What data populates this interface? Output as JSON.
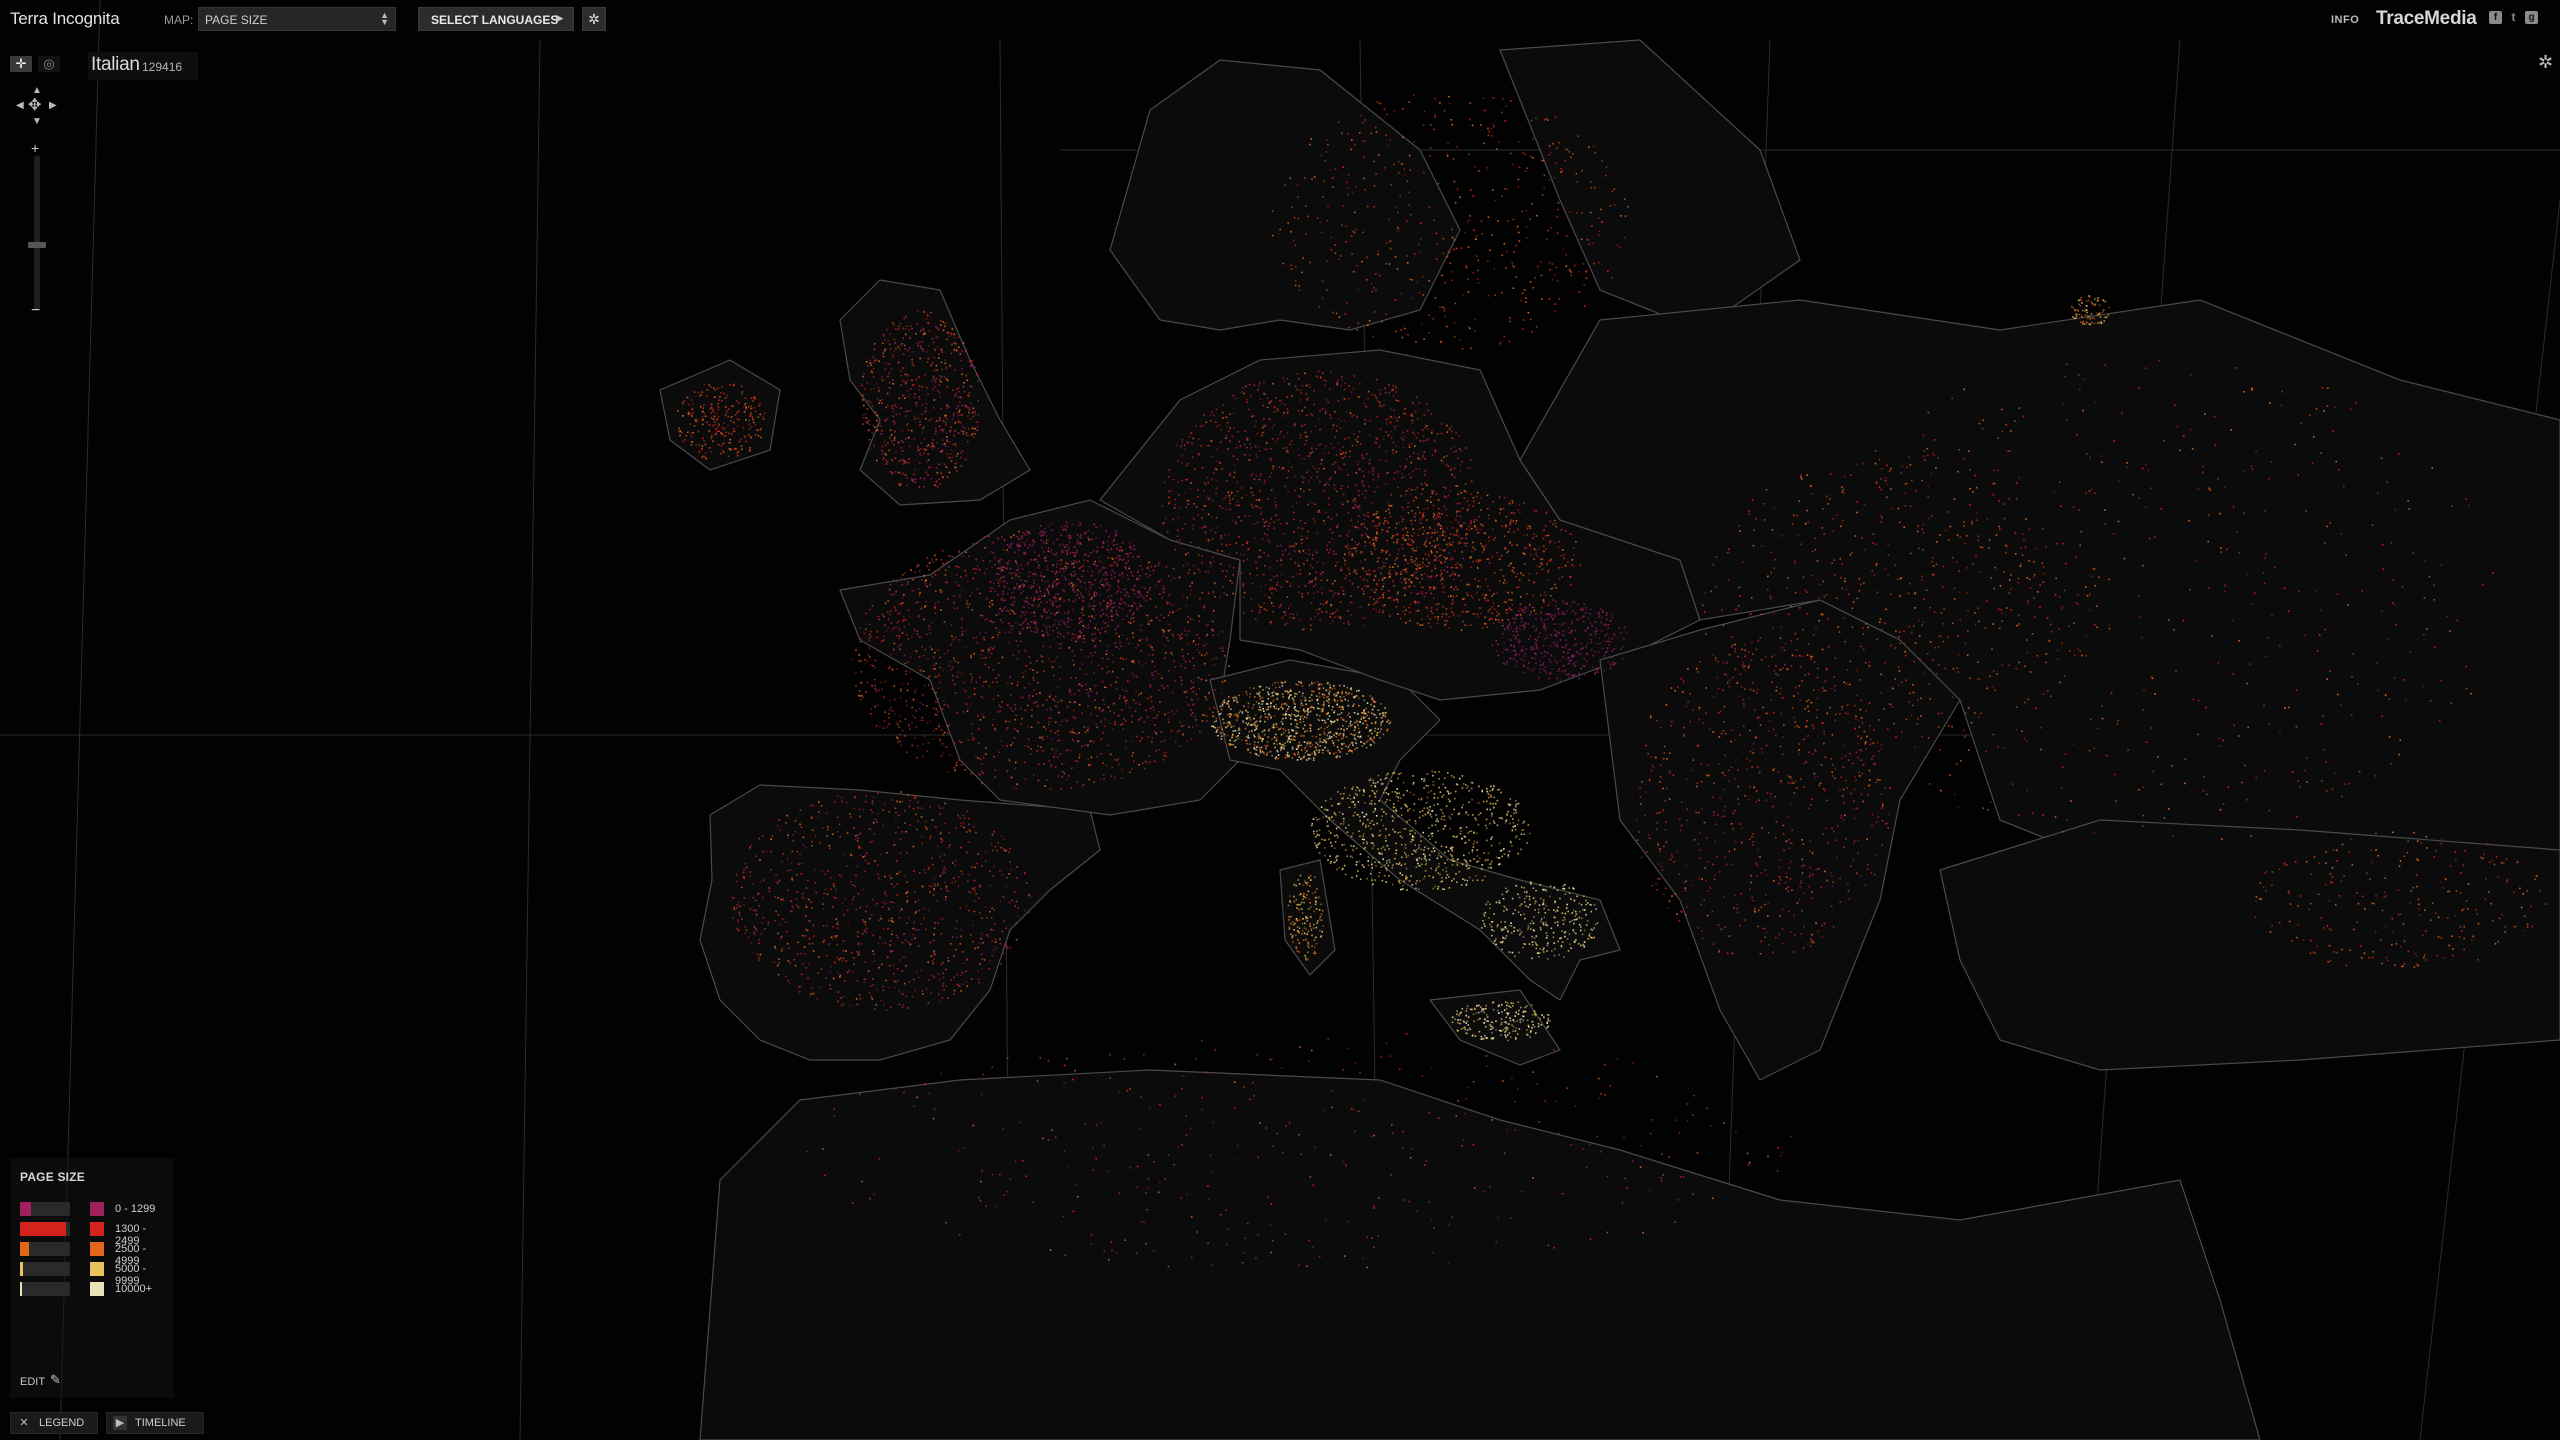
{
  "app": {
    "title": "Terra Incognita",
    "map_label": "MAP:",
    "map_select_value": "PAGE SIZE",
    "select_languages_label": "SELECT LANGUAGES",
    "info_label": "INFO",
    "brand": "TraceMedia"
  },
  "icons": {
    "map_select_arrows": "updown-arrows-icon",
    "select_languages_chevron": "chevron-right-icon",
    "settings": "gear-icon",
    "facebook": "facebook-icon",
    "twitter": "twitter-icon",
    "googleplus": "googleplus-icon",
    "corner_settings": "gear-icon",
    "points_mode": "crosshair-icon",
    "globe_mode": "globe-icon",
    "pan": "pan-arrows-icon",
    "zoom_in": "plus-icon",
    "zoom_out": "minus-icon",
    "edit": "pencil-icon",
    "legend_toggle": "close-icon",
    "timeline_play": "play-icon"
  },
  "social": {
    "facebook": "f",
    "twitter": "t",
    "googleplus": "g"
  },
  "language_filter": {
    "name": "Italian",
    "count": "129416"
  },
  "zoom": {
    "level_fraction": 0.42
  },
  "legend": {
    "title": "PAGE SIZE",
    "rows": [
      {
        "range": "0 - 1299",
        "color": "#a0205e",
        "share": 0.22
      },
      {
        "range": "1300 - 2499",
        "color": "#d4221c",
        "share": 0.92
      },
      {
        "range": "2500 - 4999",
        "color": "#e1681a",
        "share": 0.18
      },
      {
        "range": "5000 - 9999",
        "color": "#e8c25a",
        "share": 0.06
      },
      {
        "range": "10000+",
        "color": "#e9e3b8",
        "share": 0.04
      }
    ],
    "edit_label": "EDIT"
  },
  "bottom": {
    "legend_label": "LEGEND",
    "timeline_label": "TIMELINE"
  },
  "palette": {
    "background": "#020202",
    "land_fill": "#0b0b0b",
    "border_stroke": "#4a4a4a",
    "graticule": "#2b2b2b"
  }
}
